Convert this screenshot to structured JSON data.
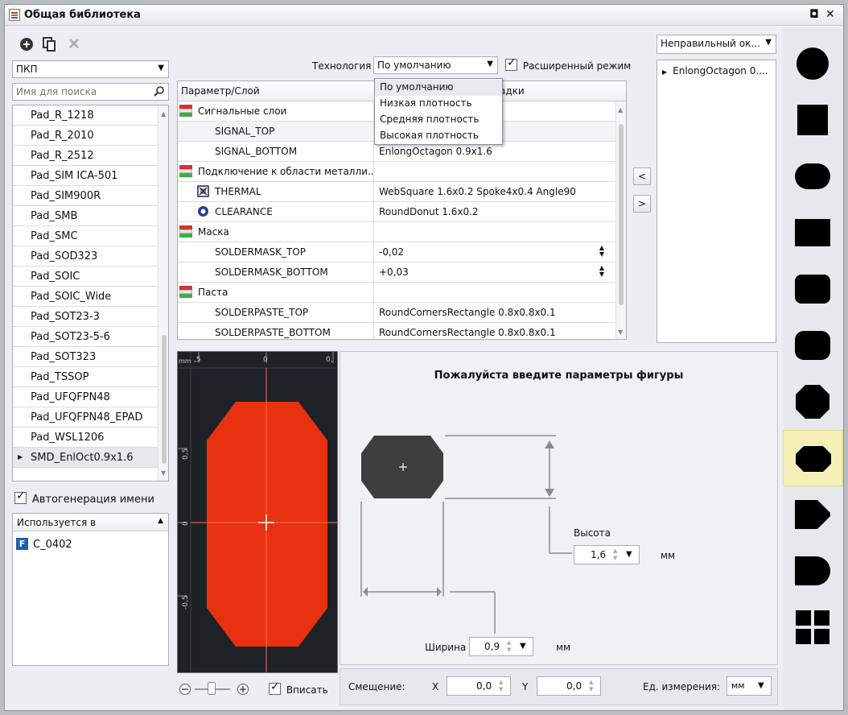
{
  "window": {
    "title": "Общая библиотека",
    "restore_glyph": "◘",
    "close_glyph": "✕"
  },
  "toolbar": {
    "add_icon": "plus-circle-icon",
    "copy_icon": "copy-icon",
    "delete_icon": "x-icon"
  },
  "left": {
    "category": "ПКП",
    "search_placeholder": "Имя для поиска",
    "items": [
      "Pad_R_1218",
      "Pad_R_2010",
      "Pad_R_2512",
      "Pad_SIM ICA-501",
      "Pad_SIM900R",
      "Pad_SMB",
      "Pad_SMC",
      "Pad_SOD323",
      "Pad_SOIC",
      "Pad_SOIC_Wide",
      "Pad_SOT23-3",
      "Pad_SOT23-5-6",
      "Pad_SOT323",
      "Pad_TSSOP",
      "Pad_UFQFPN48",
      "Pad_UFQFPN48_EPAD",
      "Pad_WSL1206",
      "SMD_EnlOct0.9x1.6"
    ],
    "selected_index": 17,
    "autoname_label": "Автогенерация имени",
    "autoname_checked": true,
    "used_in_header": "Используется в",
    "used_in": [
      {
        "badge": "F",
        "name": "C_0402"
      }
    ]
  },
  "tech": {
    "label": "Технология",
    "value": "По умолчанию",
    "options": [
      "По умолчанию",
      "Низкая плотность",
      "Средняя плотность",
      "Высокая плотность"
    ],
    "advanced_label": "Расширенный режим",
    "advanced_checked": true
  },
  "grid": {
    "col1": "Параметр/Слой",
    "col2_partial": "адки",
    "rows": [
      {
        "type": "group",
        "name": "Сигнальные слои",
        "value": ""
      },
      {
        "type": "item",
        "name": "SIGNAL_TOP",
        "value": "",
        "selected": true
      },
      {
        "type": "item",
        "name": "SIGNAL_BOTTOM",
        "value": "EnlongOctagon 0.9x1.6"
      },
      {
        "type": "group",
        "name": "Подключение к области металли...",
        "value": ""
      },
      {
        "type": "item",
        "icon": "thermal-icon",
        "name": "THERMAL",
        "value": "WebSquare 1.6x0.2 Spoke4x0.4 Angle90"
      },
      {
        "type": "item",
        "icon": "clearance-icon",
        "name": "CLEARANCE",
        "value": "RoundDonut 1.6x0.2"
      },
      {
        "type": "group",
        "name": "Маска",
        "value": ""
      },
      {
        "type": "item",
        "name": "SOLDERMASK_TOP",
        "value": "-0,02",
        "spin": true
      },
      {
        "type": "item",
        "name": "SOLDERMASK_BOTTOM",
        "value": "+0,03",
        "spin": true
      },
      {
        "type": "group",
        "name": "Паста",
        "value": ""
      },
      {
        "type": "item",
        "name": "SOLDERPASTE_TOP",
        "value": "RoundCornersRectangle 0.8x0.8x0.1"
      },
      {
        "type": "item",
        "name": "SOLDERPASTE_BOTTOM",
        "value": "RoundCornersRectangle 0.8x0.8x0.1"
      }
    ]
  },
  "move_left": "<",
  "move_right": ">",
  "right": {
    "shape_combo": "Неправильный ок...",
    "list_item": "EnlongOctagon 0....",
    "shapes": [
      "circle",
      "square",
      "obround",
      "rect",
      "rounded-rect",
      "rounded-rect-wide",
      "octagon",
      "enlong-octagon",
      "d-shape",
      "d-shape-round",
      "grid"
    ],
    "selected_shape": 7
  },
  "preview": {
    "unit": "mm",
    "x_ticks": [
      ",5",
      "0",
      "0,"
    ],
    "y_ticks": [
      "0,5",
      "0",
      "-0,5"
    ],
    "fill": "#e8320f",
    "fit_label": "Вписать",
    "fit_checked": true
  },
  "params": {
    "title": "Пожалуйста введите параметры фигуры",
    "height_label": "Высота",
    "height_value": "1,6",
    "height_unit": "мм",
    "width_label": "Ширина",
    "width_value": "0,9",
    "width_unit": "мм"
  },
  "bottom": {
    "offset_label": "Смещение:",
    "x_label": "X",
    "x_value": "0,0",
    "y_label": "Y",
    "y_value": "0,0",
    "units_label": "Ед. измерения:",
    "units_value": "мм"
  }
}
